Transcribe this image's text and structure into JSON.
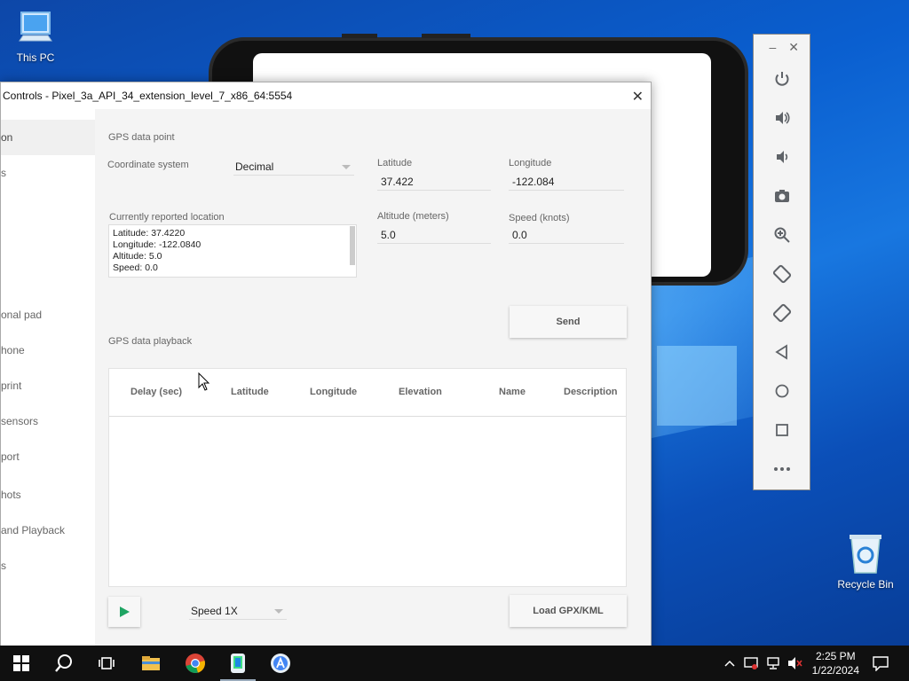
{
  "desktop": {
    "icons": [
      {
        "label": "This PC",
        "icon": "computer-icon"
      },
      {
        "label": "Recycle Bin",
        "icon": "recycle-bin-icon"
      }
    ]
  },
  "window": {
    "title": "Controls - Pixel_3a_API_34_extension_level_7_x86_64:5554",
    "close_label": "✕"
  },
  "sidebar": {
    "items": [
      {
        "label": "on",
        "active": true
      },
      {
        "label": "s"
      },
      {
        "label": ""
      },
      {
        "label": "onal pad"
      },
      {
        "label": "hone"
      },
      {
        "label": "print"
      },
      {
        "label": "sensors"
      },
      {
        "label": "port"
      },
      {
        "label": "hots"
      },
      {
        "label": "and Playback"
      },
      {
        "label": "s"
      }
    ]
  },
  "gps_point": {
    "section_label": "GPS data point",
    "coordinate_label": "Coordinate system",
    "coordinate_value": "Decimal",
    "latitude_label": "Latitude",
    "latitude_value": "37.422",
    "longitude_label": "Longitude",
    "longitude_value": "-122.084",
    "altitude_label": "Altitude (meters)",
    "altitude_value": "5.0",
    "speed_label": "Speed (knots)",
    "speed_value": "0.0",
    "reported_label": "Currently reported location",
    "reported_lines": [
      "Latitude: 37.4220",
      "Longitude: -122.0840",
      "Altitude: 5.0",
      "Speed: 0.0"
    ],
    "send_label": "Send"
  },
  "playback": {
    "section_label": "GPS data playback",
    "columns": [
      "Delay (sec)",
      "Latitude",
      "Longitude",
      "Elevation",
      "Name",
      "Description"
    ],
    "speed_value": "Speed 1X",
    "load_label": "Load GPX/KML",
    "play_color": "#1fa463"
  },
  "taskbar": {
    "time": "2:25 PM",
    "date": "1/22/2024"
  },
  "colors": {
    "accent": "#1fa463",
    "taskbar": "#101010"
  }
}
